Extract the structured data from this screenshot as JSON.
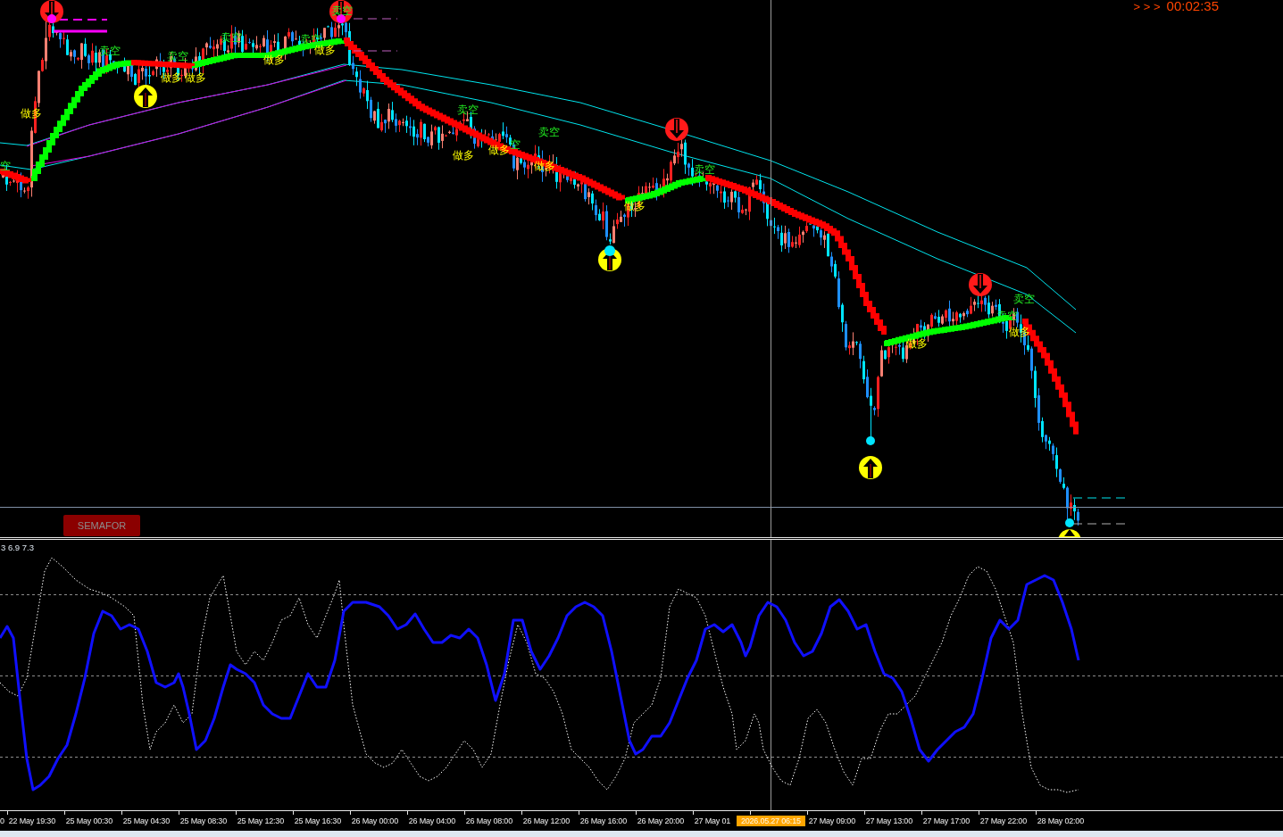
{
  "price_chart": {
    "timer": {
      "prefix": "> > >",
      "countdown": "00:02:35"
    },
    "signals": [
      {
        "kind": "short",
        "text": "空"
      },
      {
        "kind": "long",
        "text": "做多"
      },
      {
        "kind": "short",
        "text": "卖空"
      },
      {
        "kind": "short",
        "text": "卖空"
      },
      {
        "kind": "long",
        "text": "做多"
      },
      {
        "kind": "long",
        "text": "做多"
      },
      {
        "kind": "short",
        "text": "卖空"
      },
      {
        "kind": "long",
        "text": "做多"
      },
      {
        "kind": "short",
        "text": "卖空"
      },
      {
        "kind": "long",
        "text": "做多"
      },
      {
        "kind": "short",
        "text": "卖空"
      },
      {
        "kind": "short",
        "text": "卖空"
      },
      {
        "kind": "long",
        "text": "做多"
      },
      {
        "kind": "long",
        "text": "做多"
      },
      {
        "kind": "short",
        "text": "空"
      },
      {
        "kind": "short",
        "text": "卖空"
      },
      {
        "kind": "long",
        "text": "做多"
      },
      {
        "kind": "long",
        "text": "做多"
      },
      {
        "kind": "short",
        "text": "卖空"
      },
      {
        "kind": "long",
        "text": "做多"
      },
      {
        "kind": "short",
        "text": "卖空"
      },
      {
        "kind": "short",
        "text": "卖空"
      },
      {
        "kind": "long",
        "text": "做多"
      }
    ],
    "button": {
      "label": "SEMAFOR"
    }
  },
  "indicator": {
    "label": "3 6.9 7.3"
  },
  "time_axis": {
    "labels_before_cursor": [
      "0",
      "22 May 19:30",
      "25 May 00:30",
      "25 May 04:30",
      "25 May 08:30",
      "25 May 12:30",
      "25 May 16:30",
      "26 May 00:00",
      "26 May 04:00",
      "26 May 08:00",
      "26 May 12:00",
      "26 May 16:00",
      "26 May 20:00",
      "27 May 01"
    ],
    "cursor_label": "2026.05.27 06:15",
    "labels_after_cursor": [
      "27 May 09:00",
      "27 May 13:00",
      "27 May 17:00",
      "27 May 22:00",
      "28 May 02:00"
    ]
  }
}
